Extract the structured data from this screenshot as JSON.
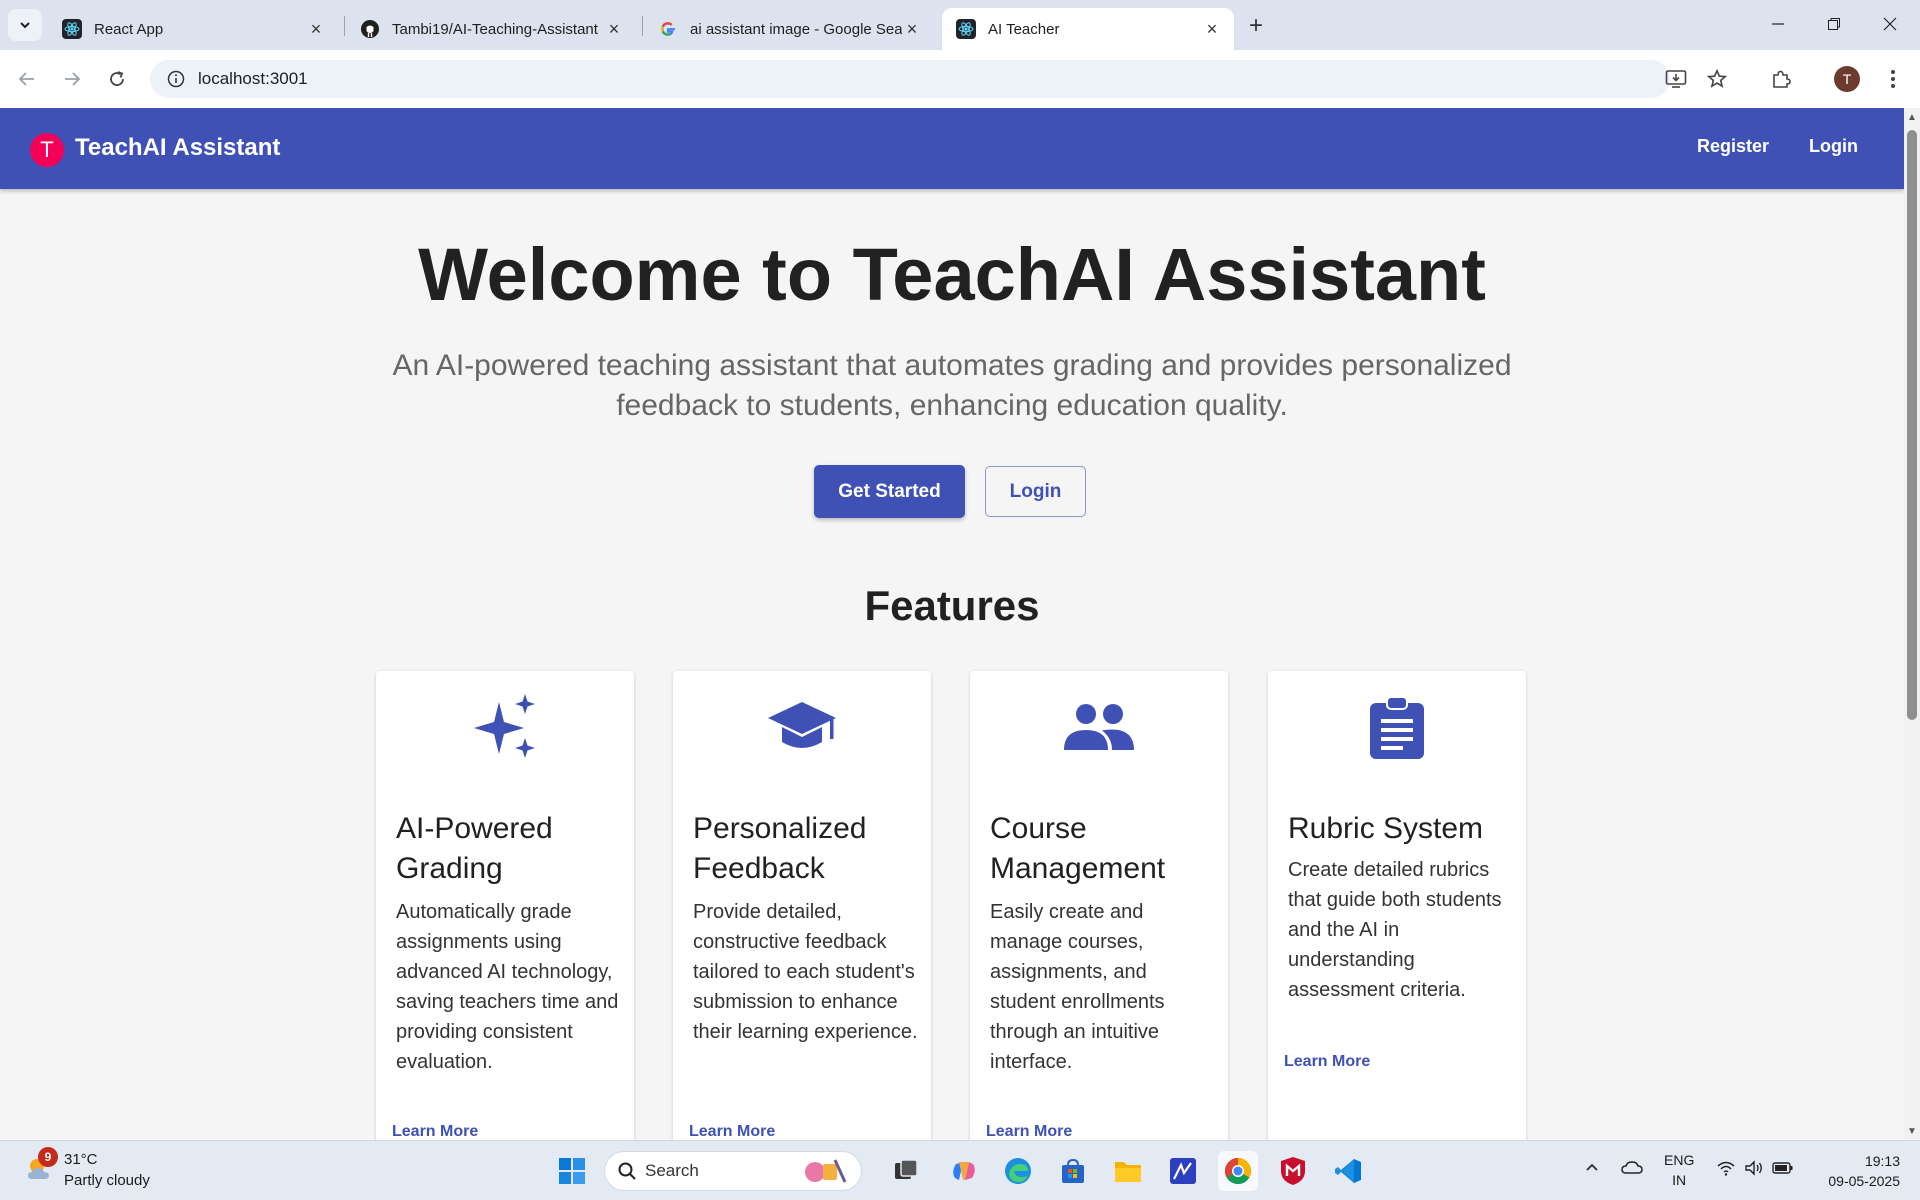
{
  "browser": {
    "tabs": [
      {
        "title": "React App",
        "active": false
      },
      {
        "title": "Tambi19/AI-Teaching-Assistant",
        "active": false
      },
      {
        "title": "ai assistant image - Google Sea",
        "active": false
      },
      {
        "title": "AI Teacher",
        "active": true
      }
    ],
    "url": "localhost:3001",
    "profile_initial": "T"
  },
  "app": {
    "logo_letter": "T",
    "brand": "TeachAI Assistant",
    "nav": {
      "register": "Register",
      "login": "Login"
    },
    "colors": {
      "primary": "#3f51b5",
      "logo": "#f50057"
    }
  },
  "hero": {
    "title": "Welcome to TeachAI Assistant",
    "subtitle": "An AI-powered teaching assistant that automates grading and provides personalized feedback to students, enhancing education quality.",
    "get_started": "Get Started",
    "login": "Login"
  },
  "features": {
    "heading": "Features",
    "items": [
      {
        "icon": "sparkles-icon",
        "title": "AI-Powered Grading",
        "desc": "Automatically grade assignments using advanced AI technology, saving teachers time and providing consistent evaluation.",
        "link": "Learn More"
      },
      {
        "icon": "graduation-cap-icon",
        "title": "Personalized Feedback",
        "desc": "Provide detailed, constructive feedback tailored to each student's submission to enhance their learning experience.",
        "link": "Learn More"
      },
      {
        "icon": "people-icon",
        "title": "Course Management",
        "desc": "Easily create and manage courses, assignments, and student enrollments through an intuitive interface.",
        "link": "Learn More"
      },
      {
        "icon": "clipboard-icon",
        "title": "Rubric System",
        "desc": "Create detailed rubrics that guide both students and the AI in understanding assessment criteria.",
        "link": "Learn More"
      }
    ]
  },
  "taskbar": {
    "weather": {
      "badge": "9",
      "temp": "31°C",
      "desc": "Partly cloudy"
    },
    "search": "Search",
    "lang1": "ENG",
    "lang2": "IN",
    "time": "19:13",
    "date": "09-05-2025"
  }
}
